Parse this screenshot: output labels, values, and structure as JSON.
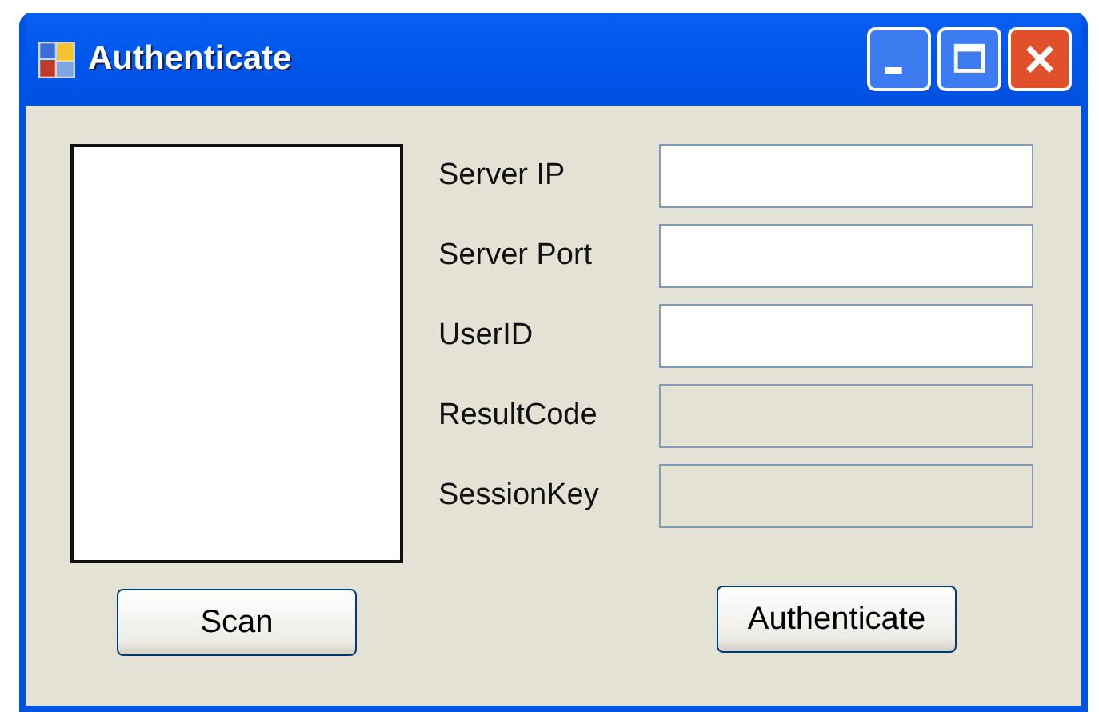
{
  "window": {
    "title": "Authenticate"
  },
  "fields": [
    {
      "label": "Server IP",
      "disabled": false
    },
    {
      "label": "Server Port",
      "disabled": false
    },
    {
      "label": "UserID",
      "disabled": false
    },
    {
      "label": "ResultCode",
      "disabled": true
    },
    {
      "label": "SessionKey",
      "disabled": true
    }
  ],
  "buttons": [
    {
      "label": "Scan"
    },
    {
      "label": "Authenticate"
    }
  ]
}
